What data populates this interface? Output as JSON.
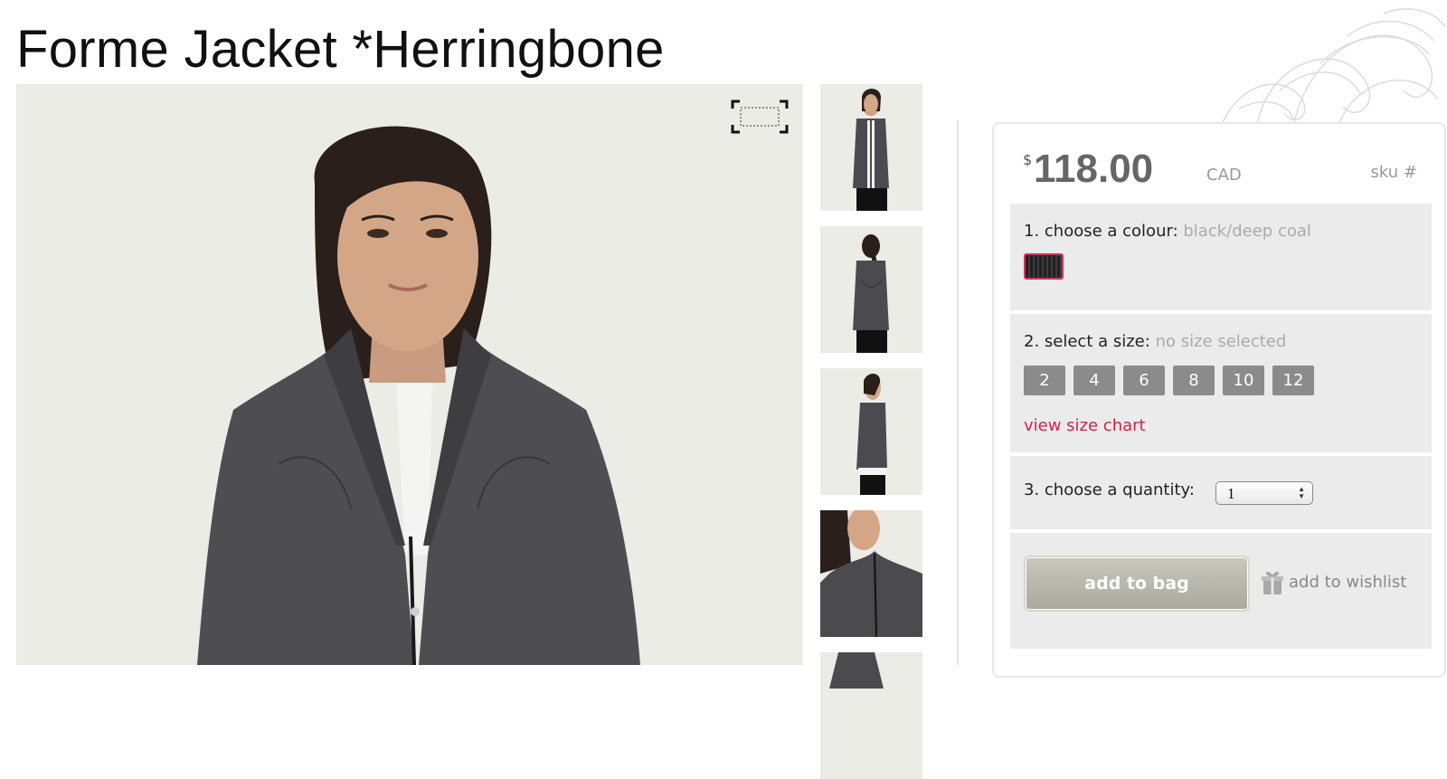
{
  "product": {
    "title": "Forme Jacket *Herringbone"
  },
  "gallery": {
    "zoom_icon": "zoom-frame-icon",
    "thumbnails": [
      {
        "view": "front"
      },
      {
        "view": "back"
      },
      {
        "view": "side"
      },
      {
        "view": "detail"
      },
      {
        "view": "more"
      }
    ]
  },
  "purchase": {
    "currency_symbol": "$",
    "price": "118.00",
    "currency": "CAD",
    "sku_label": "sku #",
    "colour": {
      "label": "1. choose a colour:",
      "value": "black/deep coal",
      "swatch_color": "#2a2a2a",
      "selected_border": "#d63052"
    },
    "size": {
      "label": "2. select a size:",
      "value": "no size selected",
      "options": [
        "2",
        "4",
        "6",
        "8",
        "10",
        "12"
      ],
      "chart_link": "view size chart"
    },
    "quantity": {
      "label": "3. choose a quantity:",
      "value": "1"
    },
    "add_to_bag": "add to bag",
    "add_to_wishlist": "add to wishlist",
    "colors": {
      "accent": "#d6214a",
      "button": "#8b8b8b",
      "section_bg": "#ebebeb"
    }
  }
}
